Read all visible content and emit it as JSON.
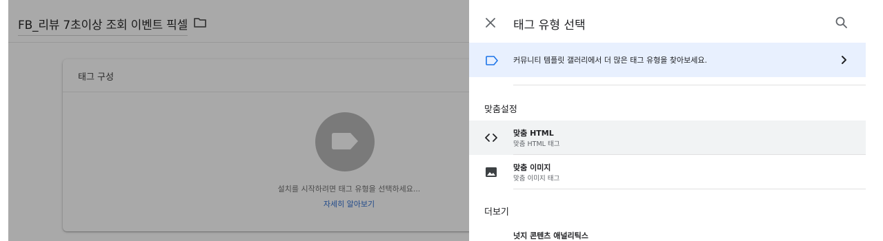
{
  "editor": {
    "tag_name": "FB_리뷰 7초이상 조회 이벤트 픽셀",
    "folder_icon": "folder-icon",
    "config_card": {
      "title": "태그 구성",
      "hint": "설치를 시작하려면 태그 유형을 선택하세요...",
      "learn_more": "자세히 알아보기",
      "icon": "tag-icon"
    }
  },
  "panel": {
    "title": "태그 유형 선택",
    "close_icon": "close-icon",
    "search_icon": "search-icon",
    "community_banner": {
      "text": "커뮤니티 템플릿 갤러리에서 더 많은 태그 유형을 찾아보세요.",
      "icon": "tag-outline-icon",
      "chevron": "chevron-right-icon"
    },
    "sections": {
      "custom": {
        "heading": "맞춤설정",
        "items": [
          {
            "title": "맞춤 HTML",
            "subtitle": "맞춤 HTML 태그",
            "icon": "code-icon"
          },
          {
            "title": "맞춤 이미지",
            "subtitle": "맞춤 이미지 태그",
            "icon": "image-icon"
          }
        ]
      },
      "more": {
        "heading": "더보기",
        "partial_item": "넛지 콘텐츠 애널리틱스"
      }
    }
  },
  "colors": {
    "backdrop": "#a9a9a9",
    "banner_bg": "#e8f0fe",
    "accent_blue": "#1a73e8",
    "selected_bg": "#f1f3f4"
  }
}
